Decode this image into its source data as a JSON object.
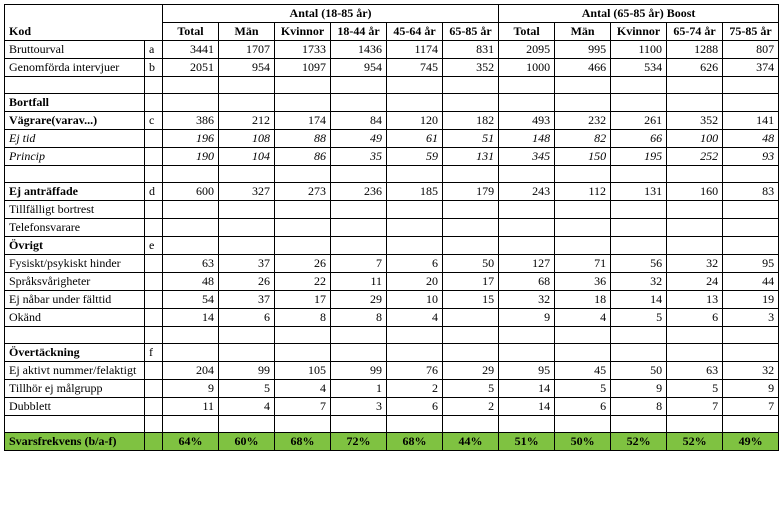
{
  "headers": {
    "group1": "Antal (18-85 år)",
    "group2": "Antal (65-85 år) Boost",
    "kod": "Kod",
    "cols1": [
      "Total",
      "Män",
      "Kvinnor",
      "18-44 år",
      "45-64 år",
      "65-85 år"
    ],
    "cols2": [
      "Total",
      "Män",
      "Kvinnor",
      "65-74 år",
      "75-85 år"
    ]
  },
  "rows": [
    {
      "label": "Bruttourval",
      "code": "a",
      "v1": [
        "3441",
        "1707",
        "1733",
        "1436",
        "1174",
        "831"
      ],
      "v2": [
        "2095",
        "995",
        "1100",
        "1288",
        "807"
      ]
    },
    {
      "label": "Genomförda intervjuer",
      "code": "b",
      "v1": [
        "2051",
        "954",
        "1097",
        "954",
        "745",
        "352"
      ],
      "v2": [
        "1000",
        "466",
        "534",
        "626",
        "374"
      ]
    },
    {
      "blank": true
    },
    {
      "label": "Bortfall",
      "bold": true
    },
    {
      "label": "Vägrare(varav...)",
      "code": "c",
      "bold": true,
      "v1": [
        "386",
        "212",
        "174",
        "84",
        "120",
        "182"
      ],
      "v2": [
        "493",
        "232",
        "261",
        "352",
        "141"
      ]
    },
    {
      "label": "Ej tid",
      "italic": true,
      "v1": [
        "196",
        "108",
        "88",
        "49",
        "61",
        "51"
      ],
      "v2": [
        "148",
        "82",
        "66",
        "100",
        "48"
      ]
    },
    {
      "label": "Princip",
      "italic": true,
      "v1": [
        "190",
        "104",
        "86",
        "35",
        "59",
        "131"
      ],
      "v2": [
        "345",
        "150",
        "195",
        "252",
        "93"
      ]
    },
    {
      "blank": true
    },
    {
      "label": "Ej anträffade",
      "code": "d",
      "bold": true,
      "v1": [
        "600",
        "327",
        "273",
        "236",
        "185",
        "179"
      ],
      "v2": [
        "243",
        "112",
        "131",
        "160",
        "83"
      ]
    },
    {
      "label": "Tillfälligt bortrest"
    },
    {
      "label": "Telefonsvarare"
    },
    {
      "label": "Övrigt",
      "code": "e",
      "bold": true
    },
    {
      "label": "Fysiskt/psykiskt hinder",
      "v1": [
        "63",
        "37",
        "26",
        "7",
        "6",
        "50"
      ],
      "v2": [
        "127",
        "71",
        "56",
        "32",
        "95"
      ]
    },
    {
      "label": "Språksvårigheter",
      "v1": [
        "48",
        "26",
        "22",
        "11",
        "20",
        "17"
      ],
      "v2": [
        "68",
        "36",
        "32",
        "24",
        "44"
      ]
    },
    {
      "label": "Ej nåbar under fälttid",
      "v1": [
        "54",
        "37",
        "17",
        "29",
        "10",
        "15"
      ],
      "v2": [
        "32",
        "18",
        "14",
        "13",
        "19"
      ]
    },
    {
      "label": "Okänd",
      "v1": [
        "14",
        "6",
        "8",
        "8",
        "4",
        ""
      ],
      "v2": [
        "9",
        "4",
        "5",
        "6",
        "3"
      ]
    },
    {
      "blank": true
    },
    {
      "label": "Övertäckning",
      "code": "f",
      "bold": true
    },
    {
      "label": "Ej aktivt nummer/felaktigt",
      "v1": [
        "204",
        "99",
        "105",
        "99",
        "76",
        "29"
      ],
      "v2": [
        "95",
        "45",
        "50",
        "63",
        "32"
      ]
    },
    {
      "label": "Tillhör ej målgrupp",
      "v1": [
        "9",
        "5",
        "4",
        "1",
        "2",
        "5"
      ],
      "v2": [
        "14",
        "5",
        "9",
        "5",
        "9"
      ]
    },
    {
      "label": "Dubblett",
      "v1": [
        "11",
        "4",
        "7",
        "3",
        "6",
        "2"
      ],
      "v2": [
        "14",
        "6",
        "8",
        "7",
        "7"
      ]
    },
    {
      "blank": true
    }
  ],
  "final": {
    "label": "Svarsfrekvens (b/a-f)",
    "v1": [
      "64%",
      "60%",
      "68%",
      "72%",
      "68%",
      "44%"
    ],
    "v2": [
      "51%",
      "50%",
      "52%",
      "52%",
      "49%"
    ]
  }
}
